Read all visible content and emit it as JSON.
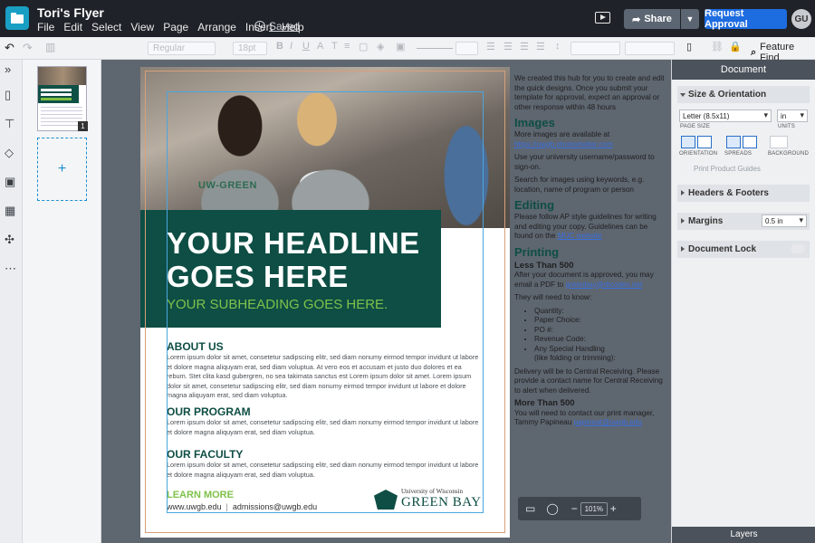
{
  "app": {
    "doc_title": "Tori's Flyer",
    "menu": [
      "File",
      "Edit",
      "Select",
      "View",
      "Page",
      "Arrange",
      "Insert",
      "Help"
    ],
    "saved_label": "Saved",
    "share_label": "Share",
    "request_label": "Request Approval",
    "user_initials": "GU"
  },
  "toolbar": {
    "font_style_placeholder": "Regular",
    "font_size_placeholder": "18pt",
    "feature_find_label": "Feature Find"
  },
  "pages_panel": {
    "page_count_badge": "1",
    "add_page_symbol": "+"
  },
  "flyer": {
    "shirt_text": "UW-GREEN",
    "headline_line1": "YOUR HEADLINE",
    "headline_line2": "GOES HERE",
    "subheading": "YOUR SUBHEADING GOES HERE.",
    "sections": [
      {
        "heading": "ABOUT US",
        "body": "Lorem ipsum dolor sit amet, consetetur sadipscing elitr, sed diam nonumy eirmod tempor invidunt ut labore et dolore magna aliquyam erat, sed diam voluptua. At vero eos et accusam et justo duo dolores et ea rebum. Stet clita kasd gubergren, no sea takimata sanctus est Lorem ipsum dolor sit amet. Lorem ipsum dolor sit amet, consetetur sadipscing elitr, sed diam nonumy eirmod tempor invidunt ut labore et dolore magna aliquyam erat, sed diam voluptua."
      },
      {
        "heading": "OUR PROGRAM",
        "body": "Lorem ipsum dolor sit amet, consetetur sadipscing elitr, sed diam nonumy eirmod tempor invidunt ut labore et dolore magna aliquyam erat, sed diam voluptua."
      },
      {
        "heading": "OUR FACULTY",
        "body": "Lorem ipsum dolor sit amet, consetetur sadipscing elitr, sed diam nonumy eirmod tempor invidunt ut labore et dolore magna aliquyam erat, sed diam voluptua."
      }
    ],
    "learn_more": "LEARN MORE",
    "website": "www.uwgb.edu",
    "separator": "|",
    "email": "admissions@uwgb.edu",
    "logo_small": "University of Wisconsin",
    "logo_big": "GREEN BAY"
  },
  "notes": {
    "intro": "We created this hub for you to create and edit the quick designs. Once you submit your template for approval, expect an approval or other response within 48 hours",
    "images_heading": "Images",
    "images_p1": "More images are available at",
    "images_link": "https://uwgb.photoshelter.com",
    "images_p2": "Use your university username/password to sign-on.",
    "images_p3": "Search for images using keywords, e.g. location, name of program or person",
    "editing_heading": "Editing",
    "editing_p": "Please follow AP style guidelines for writing and editing your copy. Guidelines can be found on the",
    "editing_link": "MUC website",
    "printing_heading": "Printing",
    "less_than_heading": "Less Than 500",
    "less_than_p": "After your document is approved, you may email a PDF to",
    "less_than_link": "greenbay@dtcodex.net",
    "need_to_know": "They will need to know:",
    "checklist": [
      "Quantity:",
      "Paper Choice:",
      "PO #:",
      "Revenue Code:",
      "Any Special Handling",
      "(like folding or trimming):"
    ],
    "delivery": "Delivery will be to Central Receiving. Please provide a contact name for Central Receiving to alert when delivered.",
    "more_than_heading": "More Than 500",
    "more_than_p": "You will need to contact our print manager, Tammy Papineau",
    "more_than_link": "papineat@uwgb.edu"
  },
  "zoom": {
    "minus": "−",
    "value": "101%",
    "plus": "+"
  },
  "right_panel": {
    "header": "Document",
    "size_orientation": "Size & Orientation",
    "page_size_value": "Letter (8.5x11)",
    "page_size_label": "PAGE SIZE",
    "units_value": "in",
    "units_label": "UNITS",
    "orientation_label": "ORIENTATION",
    "spreads_label": "SPREADS",
    "background_label": "BACKGROUND",
    "print_guides": "Print Product Guides",
    "headers_footers": "Headers & Footers",
    "margins": "Margins",
    "margins_value": "0.5 in",
    "document_lock": "Document Lock",
    "layers": "Layers"
  }
}
